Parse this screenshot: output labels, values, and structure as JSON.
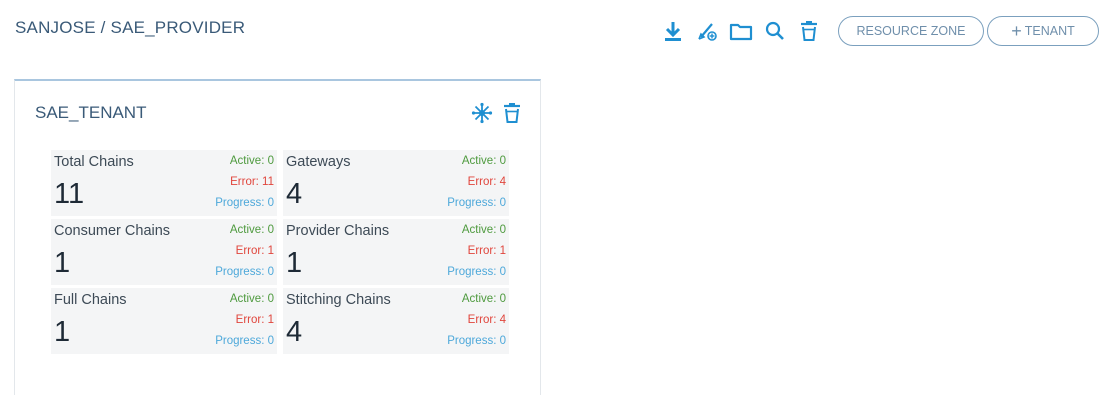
{
  "breadcrumb": "SANJOSE / SAE_PROVIDER",
  "toolbar": {
    "icons": [
      "download-icon",
      "pencil-add-icon",
      "folder-icon",
      "search-icon",
      "trash-icon"
    ],
    "resource_zone_label": "RESOURCE ZONE",
    "tenant_label": "TENANT"
  },
  "card": {
    "title": "SAE_TENANT",
    "actions": [
      "network-icon",
      "trash-icon"
    ],
    "stats": [
      {
        "label": "Total Chains",
        "value": "11",
        "active": "Active: 0",
        "error": "Error: 11",
        "progress": "Progress: 0"
      },
      {
        "label": "Gateways",
        "value": "4",
        "active": "Active: 0",
        "error": "Error: 4",
        "progress": "Progress: 0"
      },
      {
        "label": "Consumer Chains",
        "value": "1",
        "active": "Active: 0",
        "error": "Error: 1",
        "progress": "Progress: 0"
      },
      {
        "label": "Provider Chains",
        "value": "1",
        "active": "Active: 0",
        "error": "Error: 1",
        "progress": "Progress: 0"
      },
      {
        "label": "Full Chains",
        "value": "1",
        "active": "Active: 0",
        "error": "Error: 1",
        "progress": "Progress: 0"
      },
      {
        "label": "Stitching Chains",
        "value": "4",
        "active": "Active: 0",
        "error": "Error: 4",
        "progress": "Progress: 0"
      }
    ]
  },
  "colors": {
    "accent": "#1f8fd1",
    "active": "#4e9a3e",
    "error": "#e0453c",
    "progress": "#4da8da"
  }
}
